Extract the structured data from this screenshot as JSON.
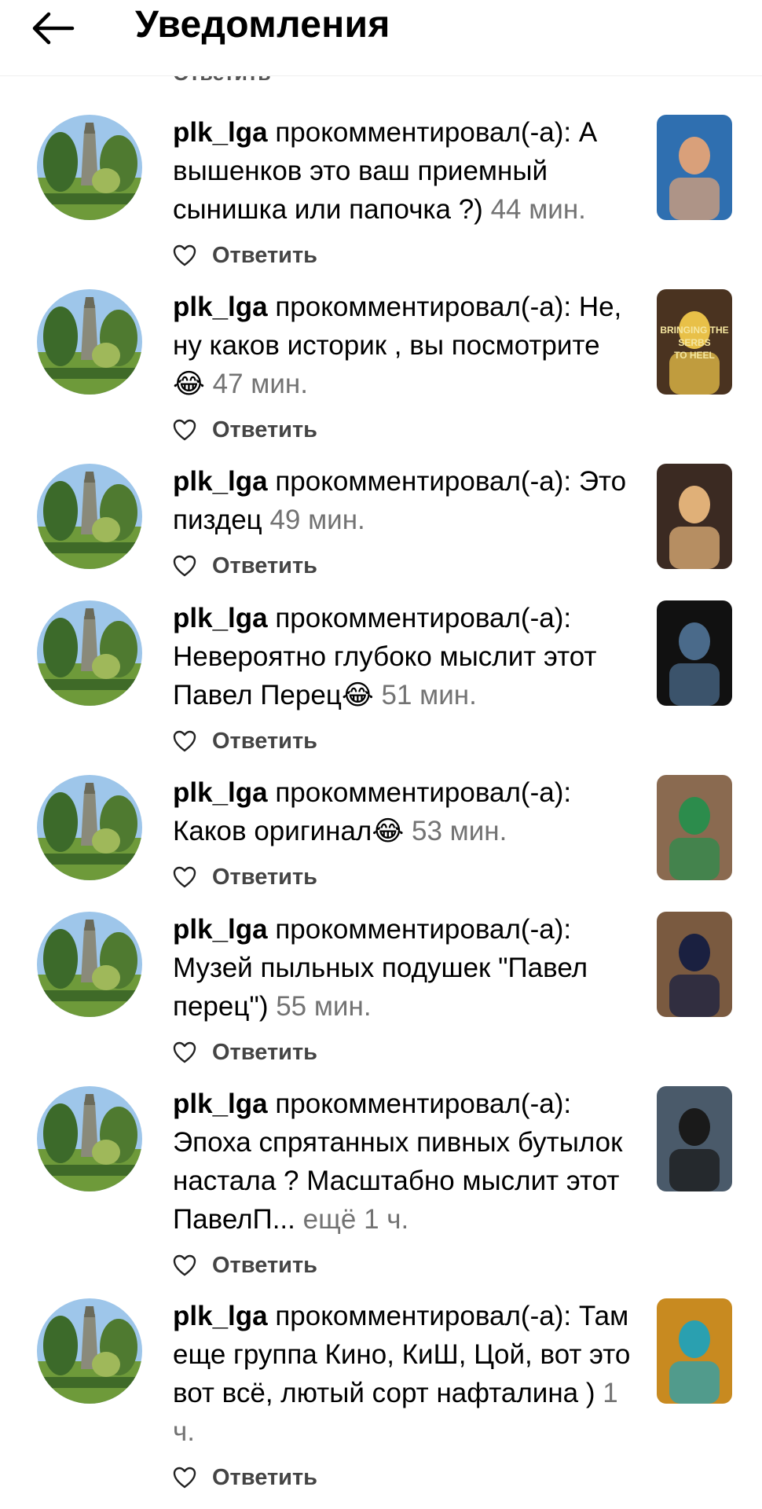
{
  "header": {
    "title": "Уведомления"
  },
  "peek": {
    "reply_label": "Ответить"
  },
  "notifications": [
    {
      "user": "plk_lga",
      "action": "прокомментировал(-а):",
      "comment": "А вышенков это ваш приемный сынишка или папочка ?)",
      "time": "44 мин.",
      "reply_label": "Ответить"
    },
    {
      "user": "plk_lga",
      "action": "прокомментировал(-а):",
      "comment": "Не, ну каков историк , вы посмотрите 😂",
      "time": "47 мин.",
      "reply_label": "Ответить"
    },
    {
      "user": "plk_lga",
      "action": "прокомментировал(-а):",
      "comment": "Это пиздец",
      "time": "49 мин.",
      "reply_label": "Ответить"
    },
    {
      "user": "plk_lga",
      "action": "прокомментировал(-а):",
      "comment": "Невероятно глубоко мыслит этот Павел Перец😂",
      "time": "51 мин.",
      "reply_label": "Ответить"
    },
    {
      "user": "plk_lga",
      "action": "прокомментировал(-а):",
      "comment": "Каков оригинал😂",
      "time": "53 мин.",
      "reply_label": "Ответить"
    },
    {
      "user": "plk_lga",
      "action": "прокомментировал(-а):",
      "comment": "Музей пыльных подушек \"Павел перец\")",
      "time": "55 мин.",
      "reply_label": "Ответить"
    },
    {
      "user": "plk_lga",
      "action": "прокомментировал(-а):",
      "comment": "Эпоха спрятанных пивных бутылок настала ? Масштабно мыслит этот ПавелП...",
      "more": "ещё",
      "time": "1 ч.",
      "reply_label": "Ответить"
    },
    {
      "user": "plk_lga",
      "action": "прокомментировал(-а):",
      "comment": "Там еще группа Кино, КиШ, Цой, вот это вот всё, лютый сорт нафталина )",
      "time": "1 ч.",
      "reply_label": "Ответить"
    }
  ],
  "thumbnails": [
    {
      "bg": "#2f6fb0",
      "accent": "#d9a07a"
    },
    {
      "bg": "#4a3320",
      "accent": "#e8c048",
      "text": "BRINGING THE SERBS TO HEEL"
    },
    {
      "bg": "#3b2a22",
      "accent": "#e0b078"
    },
    {
      "bg": "#111111",
      "accent": "#4a6a8a"
    },
    {
      "bg": "#8a6a50",
      "accent": "#2c8c4c"
    },
    {
      "bg": "#7a5a40",
      "accent": "#1a2040"
    },
    {
      "bg": "#4a5a6a",
      "accent": "#1a1a1a"
    },
    {
      "bg": "#c88a20",
      "accent": "#2aa0b0"
    }
  ]
}
